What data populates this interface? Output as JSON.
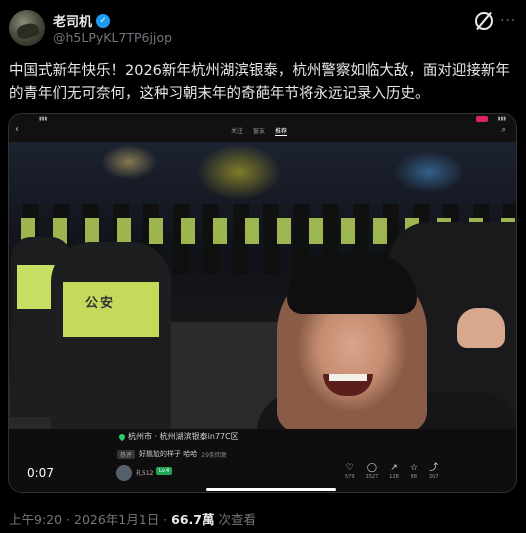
{
  "author": {
    "display_name": "老司机",
    "handle": "@h5LPyKL7TP6jjop"
  },
  "icons": {
    "avatar": "avatar",
    "verified": "verified-badge-icon",
    "grok": "grok-icon",
    "more": "more-icon"
  },
  "tweet": {
    "text": "中国式新年快乐！2026新年杭州湖滨银泰，杭州警察如临大敌，面对迎接新年的青年们无可奈何，这种习朝末年的奇葩年节将永远记录入历史。"
  },
  "video": {
    "tabs": [
      "关注",
      "窗友",
      "推荐"
    ],
    "active_tab": 2,
    "vest_text": "公安",
    "location": "杭州市 · 杭州湖滨银泰in77C区",
    "caption_tag": "热评",
    "caption": "好尴尬的样子 哈哈",
    "caption_views": "29条回复",
    "small_user": "礼512",
    "small_badge": "Lv.4",
    "timestamp": "0:07",
    "actions": [
      {
        "icon": "like-icon",
        "glyph": "♡",
        "count": "579"
      },
      {
        "icon": "comment-icon",
        "glyph": "◯",
        "count": "3527"
      },
      {
        "icon": "share-icon",
        "glyph": "↗",
        "count": "128"
      },
      {
        "icon": "star-icon",
        "glyph": "☆",
        "count": "88"
      },
      {
        "icon": "forward-icon",
        "glyph": "⤴",
        "count": "307"
      }
    ]
  },
  "footer": {
    "time": "上午9:20 · 2026年1月1日 · ",
    "views": "66.7萬",
    "views_label": " 次查看"
  },
  "colors": {
    "background": "#000000",
    "verified": "#1d9bf0",
    "muted": "#71767b",
    "vest": "#c4da5a"
  }
}
